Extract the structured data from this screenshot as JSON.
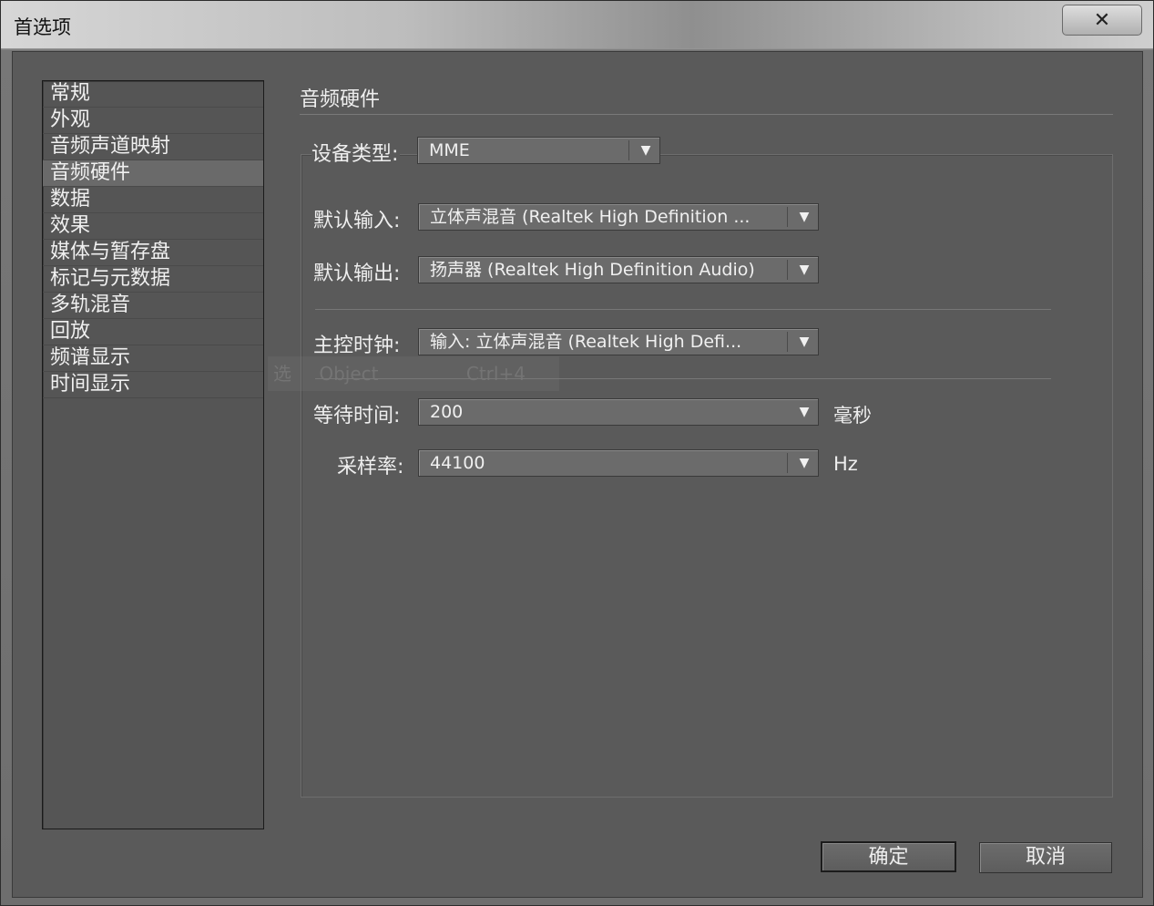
{
  "window": {
    "title": "首选项",
    "close_glyph": "✕",
    "close_icon": "close-icon"
  },
  "sidebar": {
    "items": [
      {
        "label": "常规"
      },
      {
        "label": "外观"
      },
      {
        "label": "音频声道映射"
      },
      {
        "label": "音频硬件",
        "selected": true
      },
      {
        "label": "数据"
      },
      {
        "label": "效果"
      },
      {
        "label": "媒体与暂存盘"
      },
      {
        "label": "标记与元数据"
      },
      {
        "label": "多轨混音"
      },
      {
        "label": "回放"
      },
      {
        "label": "频谱显示"
      },
      {
        "label": "时间显示"
      }
    ]
  },
  "panel": {
    "title": "音频硬件",
    "device_type": {
      "label": "设备类型:",
      "value": "MME"
    },
    "default_input": {
      "label": "默认输入:",
      "value": "立体声混音 (Realtek High Definition ..."
    },
    "default_output": {
      "label": "默认输出:",
      "value": "扬声器 (Realtek High Definition Audio)"
    },
    "master_clock": {
      "label": "主控时钟:",
      "value": "输入: 立体声混音 (Realtek High Defi..."
    },
    "latency": {
      "label": "等待时间:",
      "value": "200",
      "unit": "毫秒"
    },
    "sample_rate": {
      "label": "采样率:",
      "value": "44100",
      "unit": "Hz"
    },
    "dropdown_arrow": "▼"
  },
  "ghost_overlay": {
    "col1": "选",
    "col2": "Object",
    "col3": "Ctrl+4"
  },
  "buttons": {
    "ok": "确定",
    "cancel": "取消"
  },
  "colors": {
    "panel_bg": "#5a5a5a",
    "selected_bg": "#6a6a6a"
  }
}
